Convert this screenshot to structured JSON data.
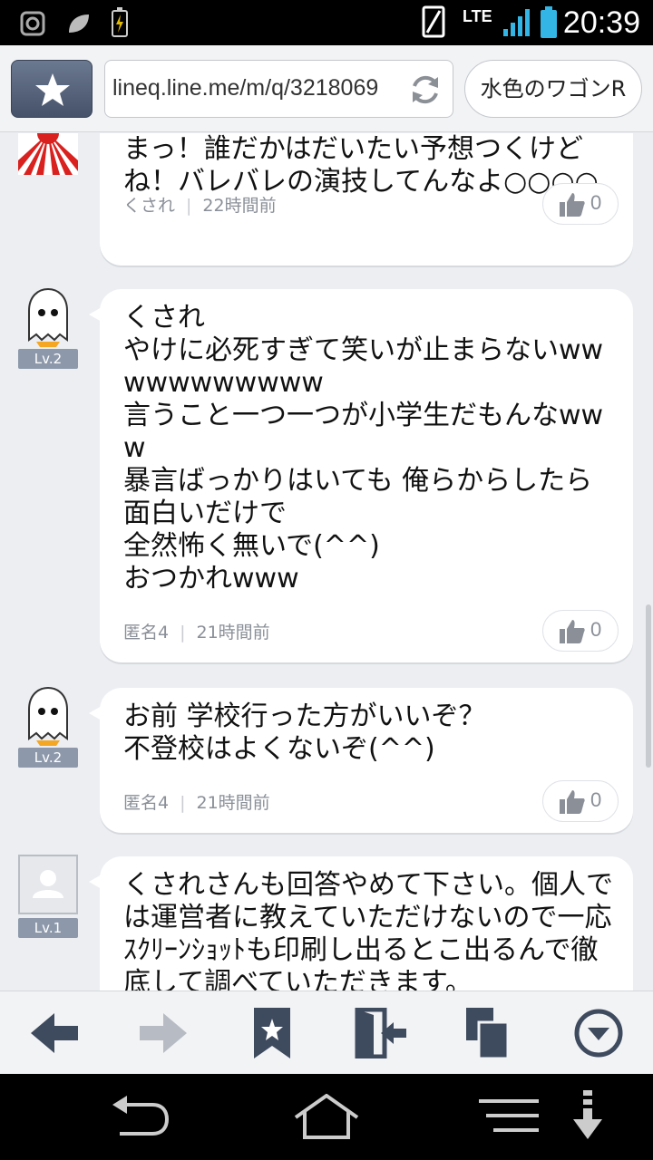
{
  "status_bar": {
    "time": "20:39",
    "network": "LTE",
    "icons": [
      "alarm-icon",
      "leaf-icon",
      "battery-charging-icon",
      "sim-icon",
      "signal-icon",
      "battery-icon"
    ]
  },
  "browser": {
    "url": "lineq.line.me/m/q/3218069",
    "page_title": "水色のワゴンR"
  },
  "answers": [
    {
      "text": "まっ！誰だかはだいたい予想つくけどね！バレバレの演技してんなよ○○○○",
      "author": "くされ",
      "time": "22時間前",
      "likes": "0"
    },
    {
      "level": "Lv.2",
      "text": "くされ\nやけに必死すぎて笑いが止まらないwwwwwwwwwww\n言うこと一つ一つが小学生だもんなwww\n暴言ばっかりはいても 俺らからしたら面白いだけで\n全然怖く無いで(^^)\nおつかれwww",
      "author": "匿名4",
      "time": "21時間前",
      "likes": "0"
    },
    {
      "level": "Lv.2",
      "text": "お前 学校行った方がいいぞ？\n不登校はよくないぞ(^^)",
      "author": "匿名4",
      "time": "21時間前",
      "likes": "0"
    },
    {
      "level": "Lv.1",
      "text": "くされさんも回答やめて下さい。個人では運営者に教えていただけないので一応ｽｸﾘｰﾝｼｮｯﾄも印刷し出るとこ出るんで徹底して調べていただきます。"
    }
  ],
  "bottom_toolbar": [
    "back-arrow-icon",
    "forward-arrow-icon",
    "bookmark-icon",
    "exit-door-icon",
    "copy-icon",
    "menu-down-icon"
  ],
  "nav_bar": [
    "back-icon",
    "home-icon",
    "menu-icon",
    "download-icon"
  ],
  "colors": {
    "accent_dark": "#46526a",
    "badge": "#8d99ab",
    "background": "#eceef1"
  }
}
